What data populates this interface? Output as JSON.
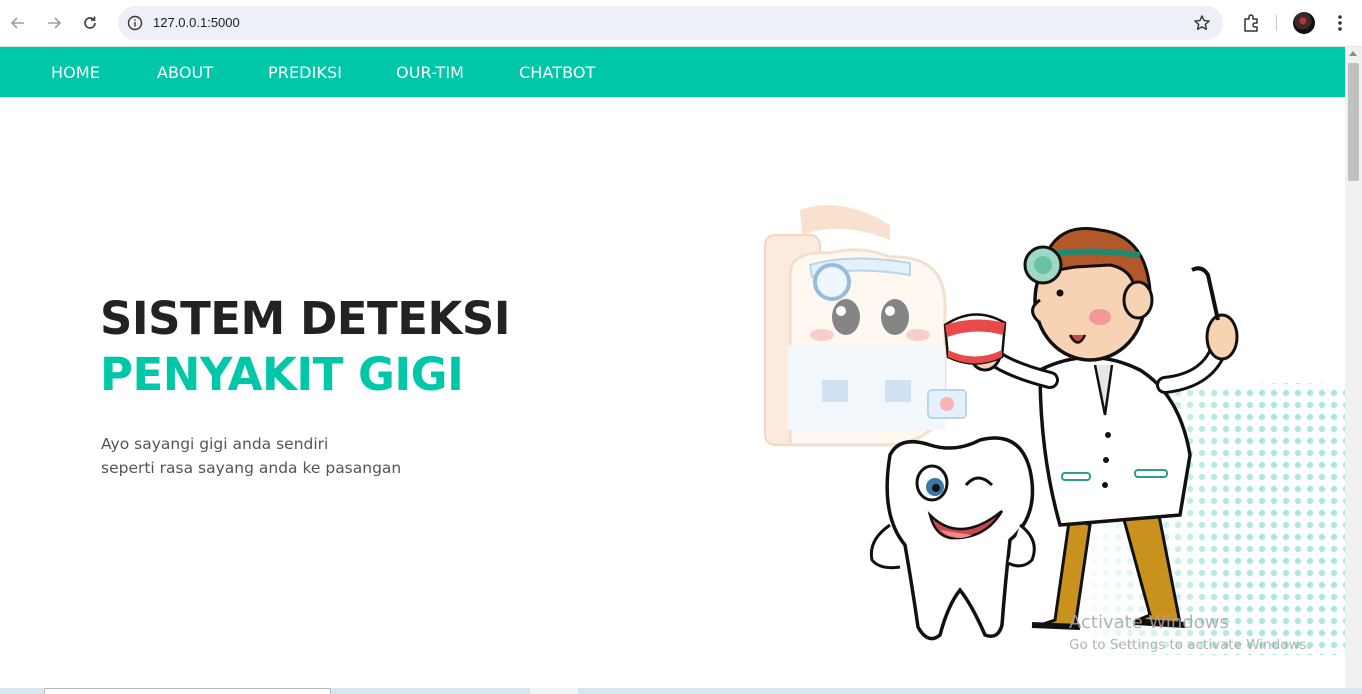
{
  "browser": {
    "url": "127.0.0.1:5000",
    "icons": [
      "back-arrow-icon",
      "forward-arrow-icon",
      "reload-icon",
      "site-info-icon",
      "bookmark-star-icon",
      "extensions-icon",
      "profile-avatar",
      "more-menu-icon"
    ]
  },
  "nav": {
    "items": [
      {
        "label": "HOME"
      },
      {
        "label": "ABOUT"
      },
      {
        "label": "PREDIKSI"
      },
      {
        "label": "OUR-TIM"
      },
      {
        "label": "CHATBOT"
      }
    ]
  },
  "hero": {
    "title": "SISTEM DETEKSI",
    "subtitle": "PENYAKIT GIGI",
    "line1": "Ayo sayangi gigi anda sendiri",
    "line2": "seperti rasa sayang anda ke pasangan"
  },
  "watermark": {
    "line1": "Activate Windows",
    "line2": "Go to Settings to activate Windows."
  },
  "colors": {
    "accent": "#00c7a8",
    "title": "#222222",
    "text": "#555555"
  }
}
